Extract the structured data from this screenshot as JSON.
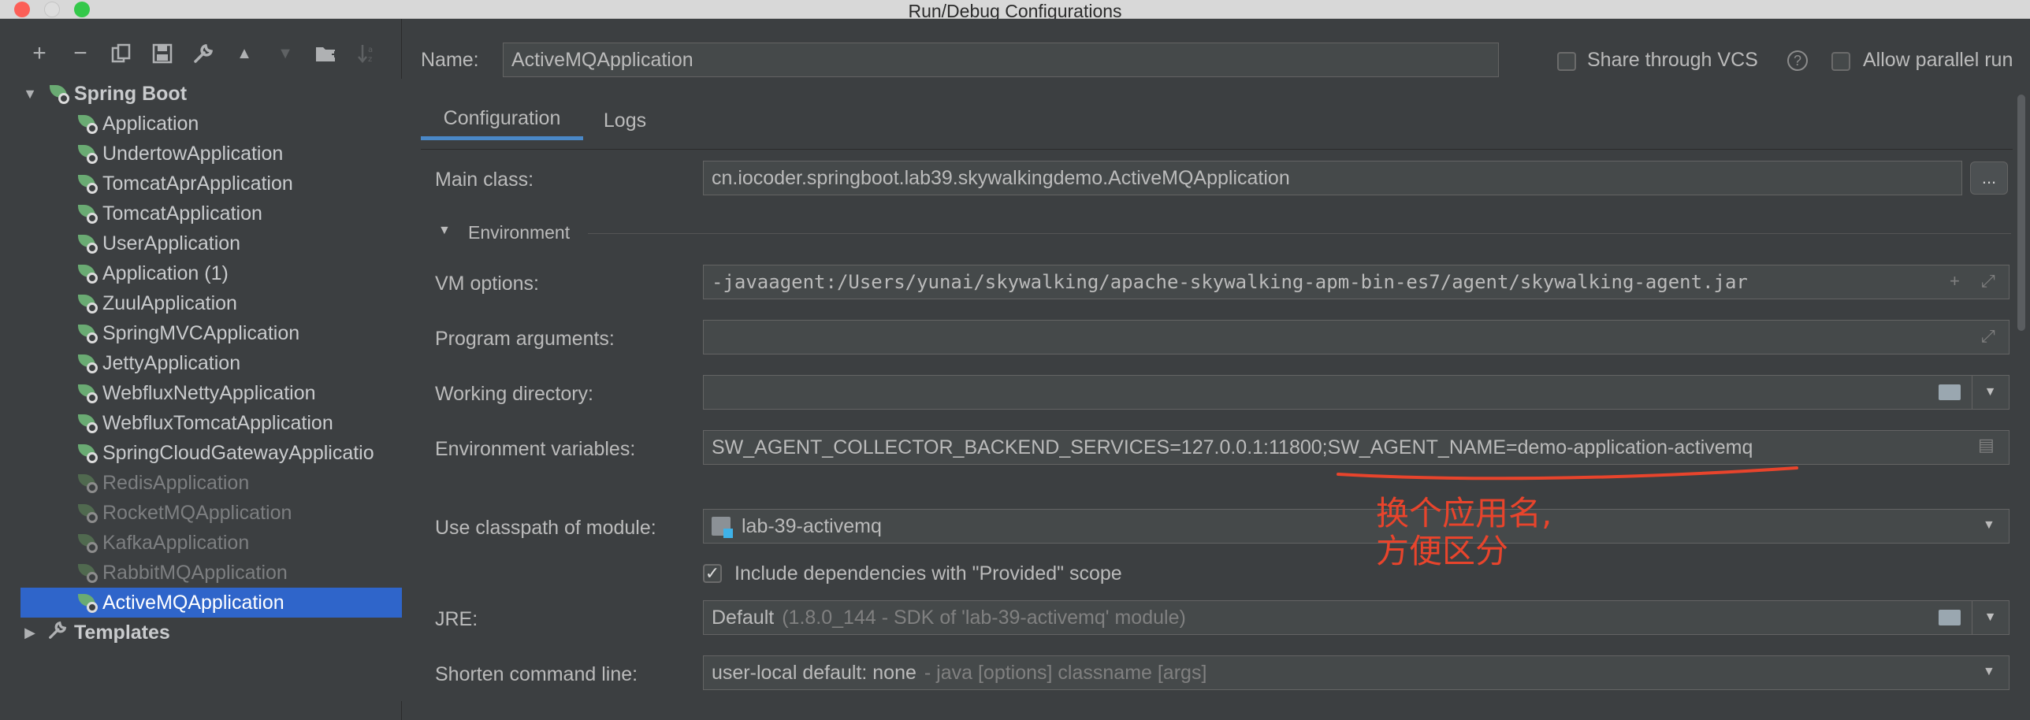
{
  "window": {
    "title": "Run/Debug Configurations"
  },
  "toolbar": {
    "icons": [
      "add-icon",
      "remove-icon",
      "copy-icon",
      "save-icon",
      "wrench-icon",
      "move-up-icon",
      "move-down-icon",
      "new-folder-icon",
      "sort-icon"
    ],
    "add": "+",
    "remove": "−",
    "up": "▲",
    "down": "▼"
  },
  "tree": {
    "root_label": "Spring Boot",
    "items": [
      {
        "label": "Application",
        "disabled": false
      },
      {
        "label": "UndertowApplication",
        "disabled": false
      },
      {
        "label": "TomcatAprApplication",
        "disabled": false
      },
      {
        "label": "TomcatApplication",
        "disabled": false
      },
      {
        "label": "UserApplication",
        "disabled": false
      },
      {
        "label": "Application (1)",
        "disabled": false
      },
      {
        "label": "ZuulApplication",
        "disabled": false
      },
      {
        "label": "SpringMVCApplication",
        "disabled": false
      },
      {
        "label": "JettyApplication",
        "disabled": false
      },
      {
        "label": "WebfluxNettyApplication",
        "disabled": false
      },
      {
        "label": "WebfluxTomcatApplication",
        "disabled": false
      },
      {
        "label": "SpringCloudGatewayApplicatio",
        "disabled": false
      },
      {
        "label": "RedisApplication",
        "disabled": true
      },
      {
        "label": "RocketMQApplication",
        "disabled": true
      },
      {
        "label": "KafkaApplication",
        "disabled": true
      },
      {
        "label": "RabbitMQApplication",
        "disabled": true
      },
      {
        "label": "ActiveMQApplication",
        "disabled": false,
        "selected": true
      }
    ],
    "templates_label": "Templates"
  },
  "header": {
    "name_label": "Name:",
    "name_value": "ActiveMQApplication",
    "share_label": "Share through VCS",
    "parallel_label": "Allow parallel run",
    "help_glyph": "?"
  },
  "tabs": [
    {
      "label": "Configuration",
      "active": true
    },
    {
      "label": "Logs",
      "active": false
    }
  ],
  "form": {
    "main_class_label": "Main class:",
    "main_class_value": "cn.iocoder.springboot.lab39.skywalkingdemo.ActiveMQApplication",
    "ellipsis": "...",
    "environment_label": "Environment",
    "vm_options_label": "VM options:",
    "vm_options_value": "-javaagent:/Users/yunai/skywalking/apache-skywalking-apm-bin-es7/agent/skywalking-agent.jar",
    "program_args_label": "Program arguments:",
    "program_args_value": "",
    "working_dir_label": "Working directory:",
    "working_dir_value": "",
    "env_vars_label": "Environment variables:",
    "env_vars_value": "SW_AGENT_COLLECTOR_BACKEND_SERVICES=127.0.0.1:11800;SW_AGENT_NAME=demo-application-activemq",
    "classpath_label": "Use classpath of module:",
    "classpath_value": "lab-39-activemq",
    "include_deps_label": "Include dependencies with \"Provided\" scope",
    "include_deps_checked": true,
    "jre_label": "JRE:",
    "jre_value": "Default",
    "jre_hint": "(1.8.0_144 - SDK of 'lab-39-activemq' module)",
    "shorten_label": "Shorten command line:",
    "shorten_value": "user-local default: none",
    "shorten_hint": "- java [options] classname [args]"
  },
  "annotation": {
    "line1": "换个应用名,",
    "line2": "方便区分",
    "color": "#e8442c"
  },
  "colors": {
    "background": "#3c3f41",
    "selection": "#2f65ca",
    "field_bg": "#45494a",
    "tab_accent": "#4a88c7",
    "spring_green": "#6aab73"
  }
}
